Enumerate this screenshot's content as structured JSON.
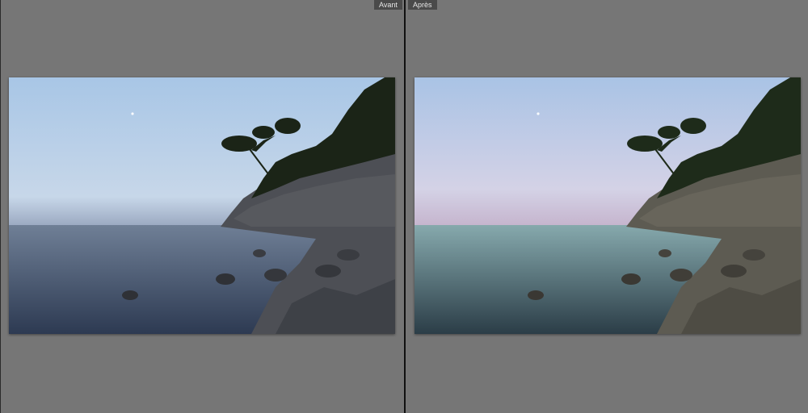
{
  "compare": {
    "before_label": "Avant",
    "after_label": "Après"
  },
  "colors": {
    "workspace_bg": "#777777",
    "divider": "#111111",
    "label_bg": "#4a4a4a",
    "label_text": "#e6e6e6"
  },
  "photos": {
    "before": {
      "sky_top": "#a8c6e6",
      "sky_bottom": "#c7d7e9",
      "horizon_haze": "#9aa8c0",
      "water_top": "#6f7f96",
      "water_bottom": "#2d3a52",
      "foliage": "#1b2417",
      "rock": "#4d4f55"
    },
    "after": {
      "sky_top": "#a9c3e5",
      "sky_bottom": "#d4d2e6",
      "horizon_haze": "#c5b4cd",
      "water_top": "#86a9ad",
      "water_bottom": "#2b3d47",
      "foliage": "#1e2b1a",
      "rock": "#5d5b52"
    }
  }
}
